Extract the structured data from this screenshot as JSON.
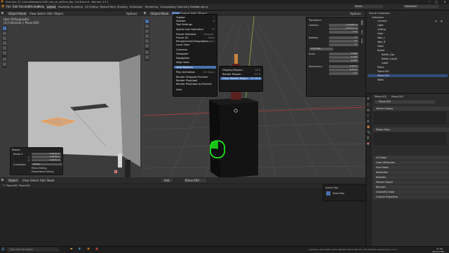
{
  "window": {
    "title": "Find_Bar_02 | Docs\\Blender\\Ch08_mid_sb_all\\Find_Bar_Ch08.blend - Blender 3.3.1",
    "minimize": "–",
    "maximize": "□",
    "close": "✕"
  },
  "menubar": {
    "items": [
      "File",
      "Edit",
      "Render",
      "Window",
      "Help"
    ],
    "workspaces": [
      "Layout",
      "Modeling",
      "Sculpting",
      "UV Editing",
      "Texture Paint",
      "Shading",
      "Animation",
      "Rendering",
      "Compositing",
      "Geometry Nodes",
      "Scripting"
    ],
    "active_workspace": "Layout",
    "scene": "Scene",
    "view_layer": "ViewLayer"
  },
  "left_view": {
    "mode": "Object Mode",
    "menu": [
      "View",
      "Select",
      "Add",
      "Object"
    ],
    "overlay_line1": "User Orthographic",
    "overlay_line2": "(2) Collection | Plane.002",
    "options": "Options",
    "panel": {
      "title": "Resize",
      "row1_label": "Resize X",
      "row1_value": "0.4676 m",
      "row2_label": "Y",
      "row2_value": "0.4676 m",
      "row3_label": "Z",
      "row3_value": "0.4676 m",
      "orientation_label": "Orientation",
      "orientation_value": "Global",
      "mirror_editing": "Mirror Editing",
      "proportional_editing": "Proportional Editing"
    }
  },
  "center_view": {
    "mode": "Object Mode",
    "menu": [
      "View",
      "Select",
      "Add",
      "Object"
    ],
    "options": "Options",
    "context_menu": {
      "items": [
        {
          "label": "Toolbar",
          "shortcut": "T"
        },
        {
          "label": "Sidebar",
          "shortcut": "N"
        },
        {
          "label": "Tool Settings",
          "shortcut": ""
        },
        {
          "label": "Adjust Last Operation",
          "shortcut": "F9"
        },
        {
          "label": "Frame Selected",
          "shortcut": "Numpad ."
        },
        {
          "label": "Frame All",
          "shortcut": "Home"
        },
        {
          "label": "Perspective/Orthographic",
          "shortcut": "Numpad 5"
        },
        {
          "label": "Local View",
          "shortcut": ""
        },
        {
          "label": "Cameras",
          "shortcut": ""
        },
        {
          "label": "Viewpoint",
          "shortcut": ""
        },
        {
          "label": "Navigation",
          "shortcut": ""
        },
        {
          "label": "Align View",
          "shortcut": ""
        },
        {
          "label": "View Regions",
          "shortcut": ""
        },
        {
          "label": "Play Animation",
          "shortcut": "Ctrl Space"
        },
        {
          "label": "Render Viewport Preview",
          "shortcut": ""
        },
        {
          "label": "Render Playblast",
          "shortcut": ""
        },
        {
          "label": "Render Playblast as Preview",
          "shortcut": ""
        },
        {
          "label": "Area",
          "shortcut": ""
        }
      ],
      "highlighted": "View Regions"
    },
    "submenu": {
      "items": [
        {
          "label": "Clipping Region...",
          "shortcut": "Alt B"
        },
        {
          "label": "Render Region...",
          "shortcut": "Ctrl B"
        },
        {
          "label": "Clear Render Region",
          "shortcut": "Ctrl Alt B"
        }
      ],
      "highlighted": "Clear Render Region"
    },
    "n_panel": {
      "transform_title": "Transform",
      "location_label": "Location:",
      "location": [
        "1.11164 m",
        "0.07411 m",
        "0 m"
      ],
      "rotation_label": "Rotation:",
      "rotation": [
        "0°",
        "0°",
        "0°"
      ],
      "mode": "XYZ Euler",
      "scale_label": "Scale:",
      "scale": [
        "2.095",
        "2.095",
        "2.095"
      ],
      "dimensions_label": "Dimensions:",
      "dimensions": [
        "4.19 m",
        "4.19 m",
        "0 m"
      ],
      "tabs": [
        "Item",
        "Tool",
        "View"
      ]
    }
  },
  "bottom_editor": {
    "mode": "Object",
    "menu": [
      "View",
      "Select",
      "Add",
      "Node"
    ],
    "slot": "Slot",
    "material": "Plane.002",
    "crumb_object": "Plane.002",
    "crumb_mesh": "Plane.002",
    "tool_panel_title": "Active Tool",
    "tool_name": "Select Box"
  },
  "outliner": {
    "title": "Scene Collection",
    "rows": [
      "Collection",
      "Camera",
      "Light",
      "Ceiling",
      "Floor",
      "Wall_L",
      "Wall_R",
      "Table",
      "Bottle",
      "Bottle_Cap",
      "Bottle_Liquid",
      "Label",
      "Plane",
      "Plane.001",
      "Plane.002",
      "Walls"
    ],
    "selected": "Plane.002"
  },
  "properties": {
    "breadcrumb_object": "Plane.002",
    "breadcrumb_data": "Plane.002",
    "name_field": "Plane.002",
    "sections": [
      "Vertex Groups",
      "Shape Keys",
      "UV Maps",
      "Color Attributes",
      "Face Maps",
      "Attributes",
      "Normals",
      "Texture Space",
      "Remesh",
      "Geometry Data",
      "Custom Properties"
    ]
  },
  "statusbar": {
    "search_placeholder": "Type here to search",
    "stats": "Collection | Plane.002 | Verts:148,420 | Faces:146,112 | Tris:292,224 | Objects:1/21 | 3.3.1",
    "time": "11:40",
    "date": "28-10-2022"
  },
  "colors": {
    "accent": "#4772b3",
    "selection_orange": "#ff9a2e",
    "mouse_icon_green": "#19e619"
  }
}
